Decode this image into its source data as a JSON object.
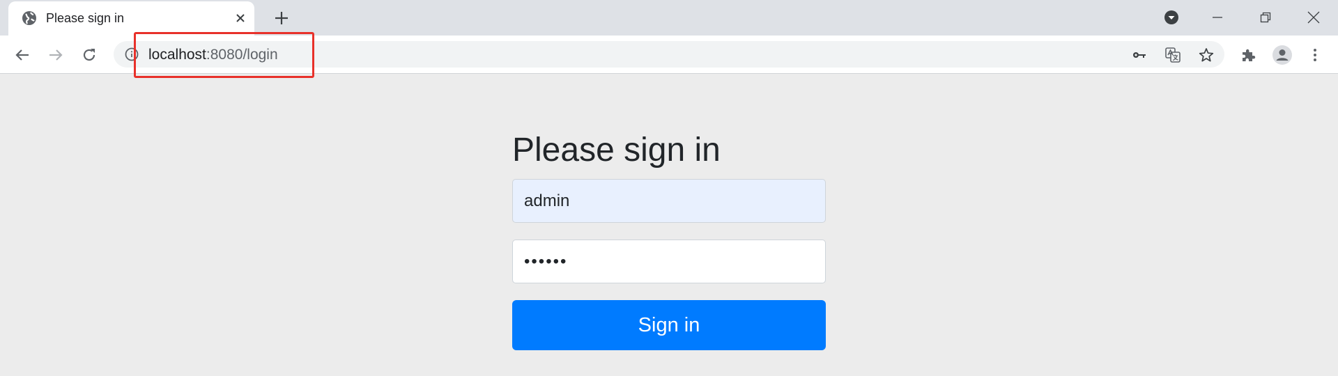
{
  "tab": {
    "title": "Please sign in",
    "icon": "globe-icon"
  },
  "address_bar": {
    "host": "localhost",
    "path": ":8080/login"
  },
  "page": {
    "heading": "Please sign in",
    "username_value": "admin",
    "password_value": "••••••",
    "submit_label": "Sign in"
  },
  "colors": {
    "primary_button": "#007bff",
    "autofill_field": "#e8f0fe",
    "page_background": "#ececec",
    "highlight_box": "#e8312a"
  }
}
